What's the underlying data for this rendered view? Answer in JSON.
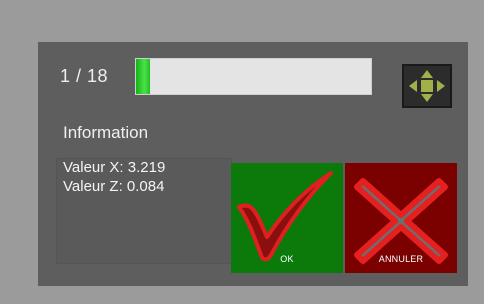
{
  "dialog": {
    "counter": "1 / 18",
    "progress": {
      "fraction": 0.06,
      "fill_color": "#2ecc2e",
      "track_color": "#e4e4e4"
    },
    "move_icon": "four-direction-arrows-icon",
    "info_title": "Information",
    "info_lines": [
      "Valeur X: 3.219",
      "Valeur Z: 0.084"
    ],
    "ok_button": {
      "label": "OK",
      "icon": "checkmark-icon",
      "color": "#0b7a0b"
    },
    "cancel_button": {
      "label": "ANNULER",
      "icon": "cross-icon",
      "color": "#7b0000"
    }
  }
}
